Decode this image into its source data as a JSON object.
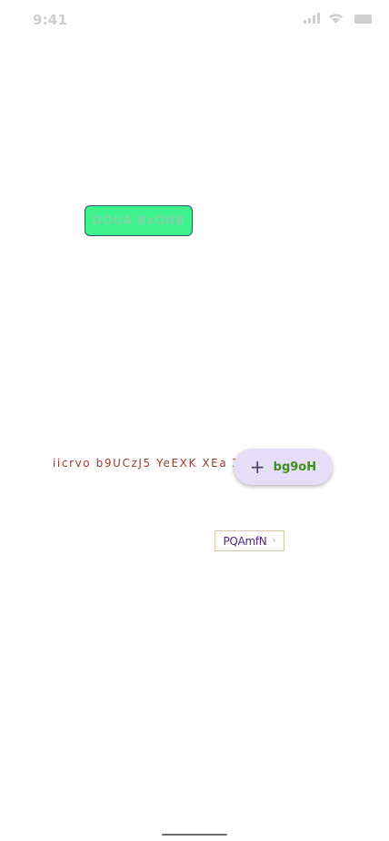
{
  "status_bar": {
    "time": "9:41",
    "icons": [
      "signal-icon",
      "wifi-icon",
      "battery-icon"
    ]
  },
  "green_button": {
    "label": "DOUA BxONB",
    "colors": {
      "background": "#3ef28d",
      "border": "#37507a",
      "text": "#79d9a4"
    }
  },
  "marquee": {
    "text": "iicrvo b9UCzJ5 YeEXK XEa                ZQe u",
    "color": "#9b3b30"
  },
  "fab": {
    "icon": "plus-icon",
    "plus_glyph": "+",
    "label": "bg9oH",
    "colors": {
      "background": "#e5def6",
      "icon": "#4a3b67",
      "label": "#3f8f1e"
    }
  },
  "chip": {
    "label": "PQAmfN",
    "icon": "chevron-right-icon",
    "chevron_glyph": "›",
    "colors": {
      "border": "#d4c9a8",
      "text": "#4b2a7b"
    }
  }
}
